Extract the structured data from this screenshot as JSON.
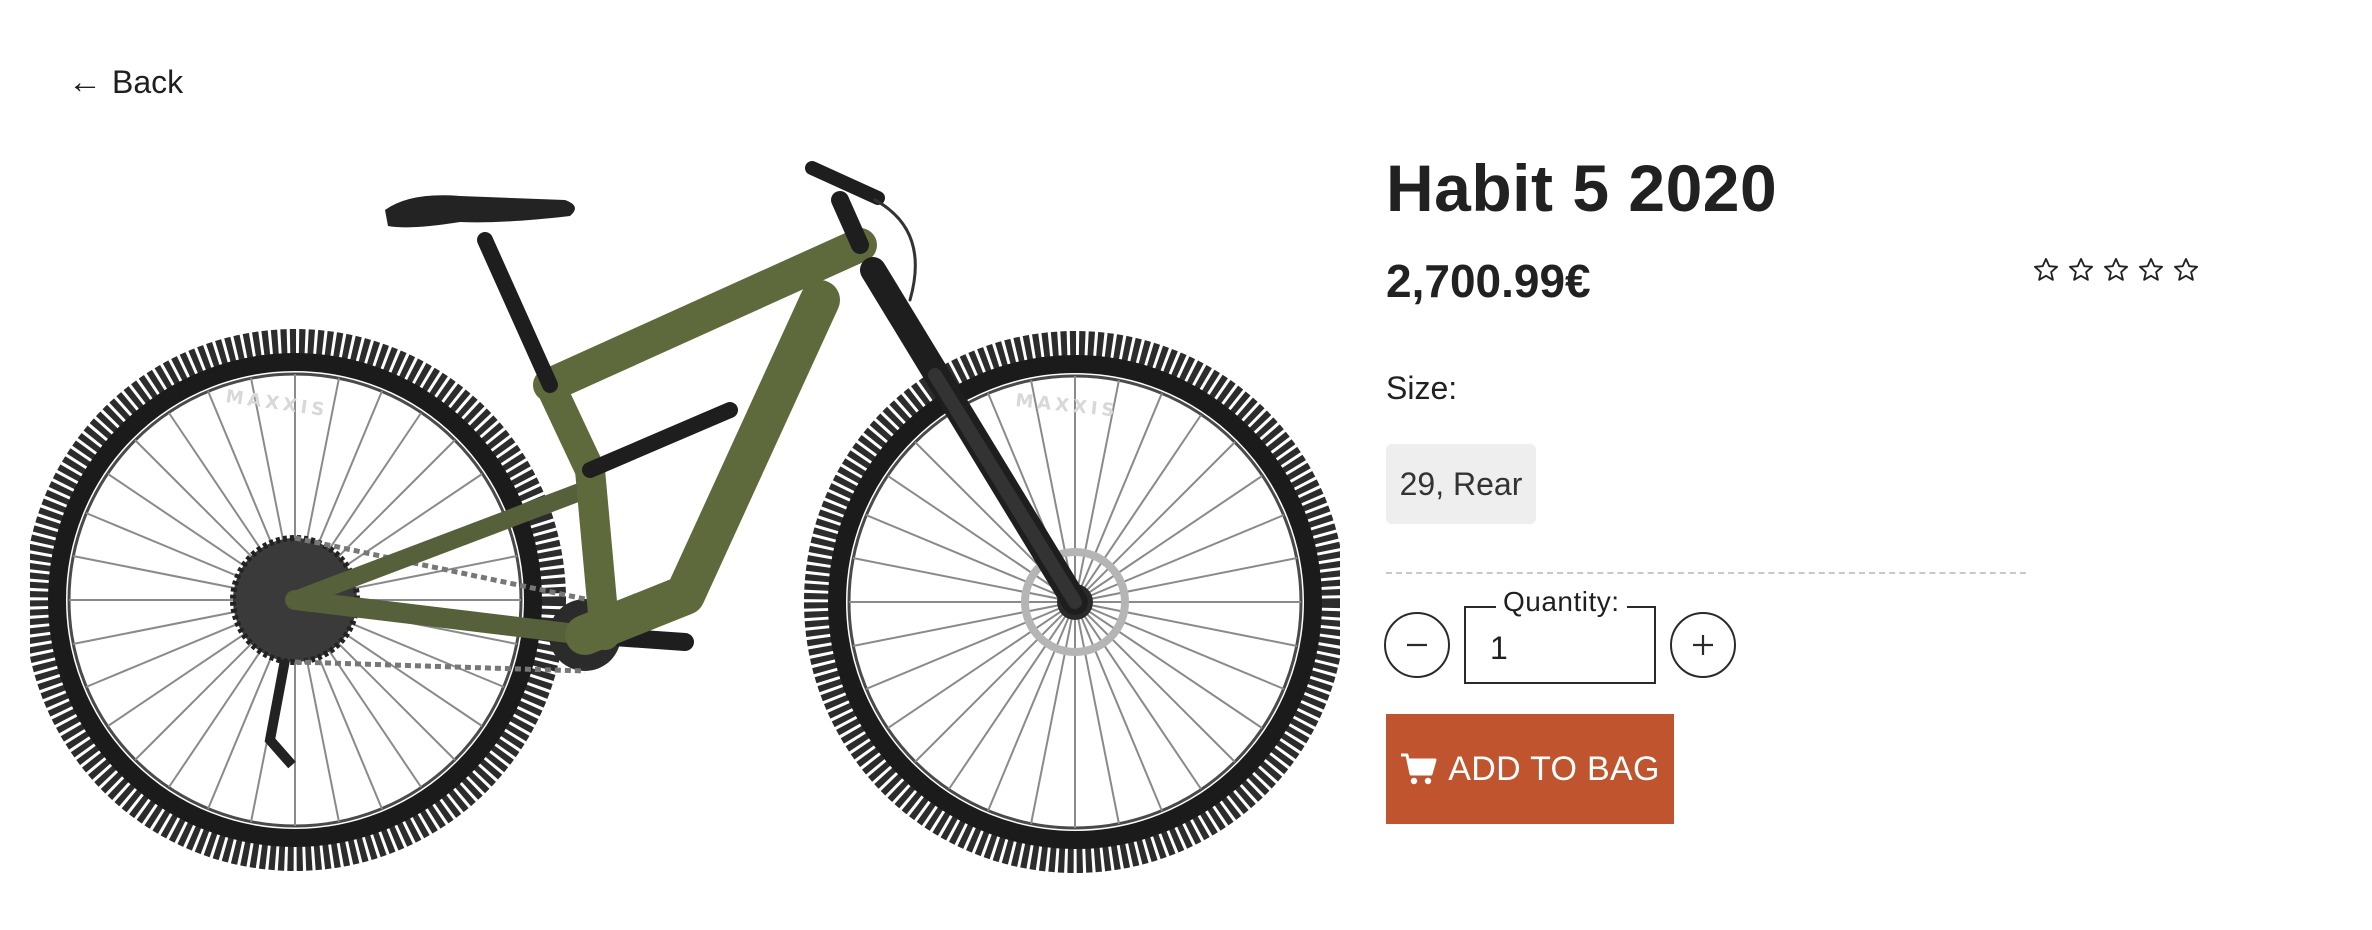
{
  "nav": {
    "back_label": "Back",
    "back_arrow": "←"
  },
  "product": {
    "image_alt": "Habit 5 2020",
    "image_icon": "mountain-bike-photo",
    "title": "Habit 5 2020",
    "price": "2,700.99€",
    "rating": {
      "filled": 0,
      "max": 5
    }
  },
  "size": {
    "label": "Size:",
    "options": [
      "29, Rear"
    ]
  },
  "quantity": {
    "label": "Quantity:",
    "value": "1"
  },
  "actions": {
    "add_to_bag_label": "ADD TO BAG",
    "add_to_bag_icon": "cart-icon"
  },
  "colors": {
    "accent": "#c0542e",
    "frame": "#5f6a3c",
    "text": "#212121",
    "chip_bg": "#eeeeee"
  }
}
